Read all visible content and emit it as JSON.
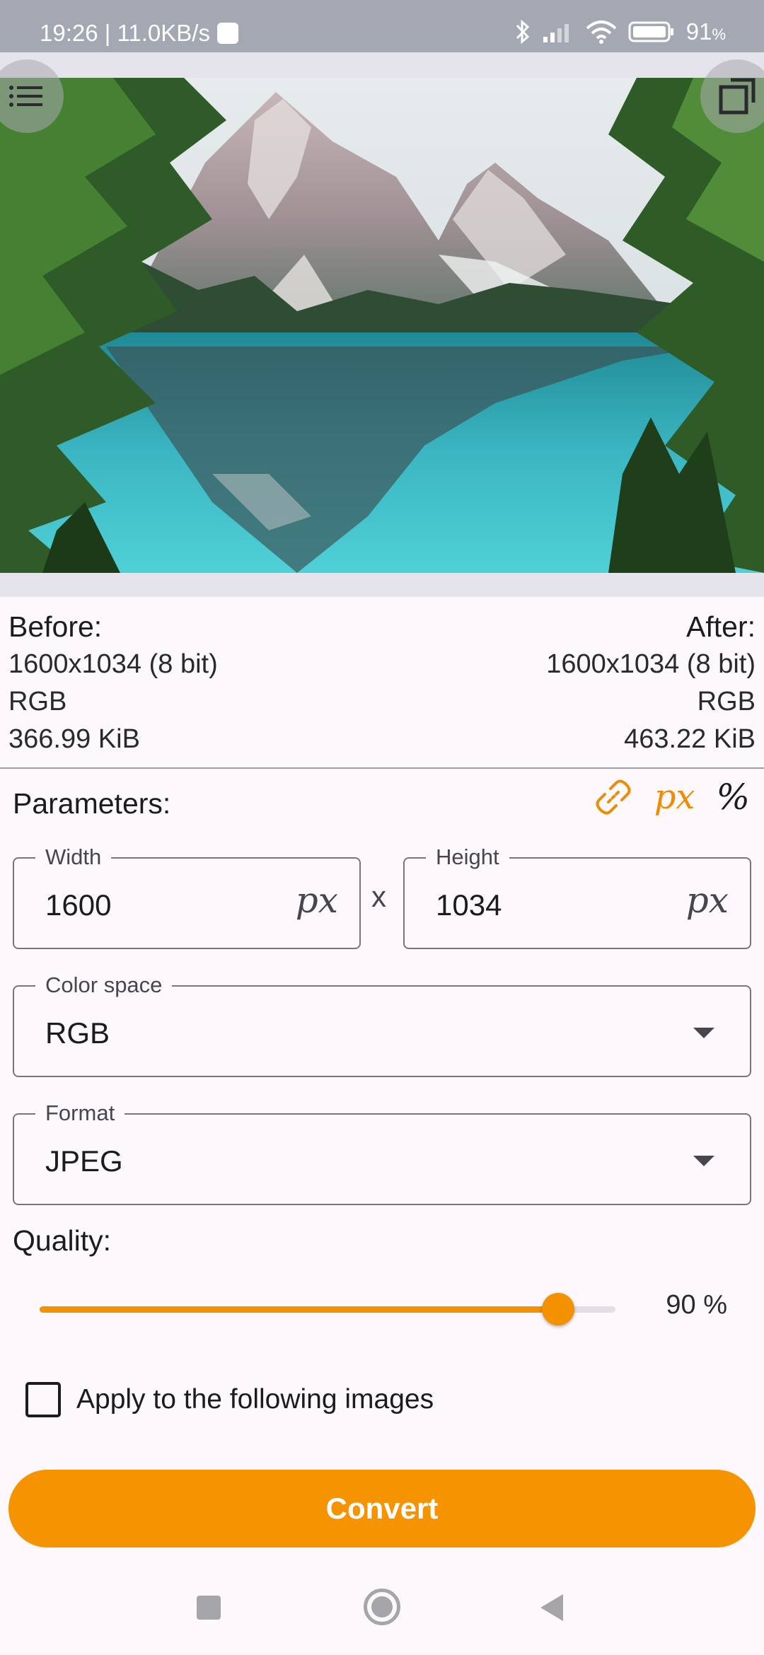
{
  "status_bar": {
    "time_speed": "19:26 | 11.0KB/s",
    "battery_value": "91",
    "battery_unit": "%"
  },
  "image_preview": {
    "menu_icon": "menu-list-icon",
    "expand_icon": "expand-icon"
  },
  "info": {
    "before": {
      "label": "Before:",
      "dimensions": "1600x1034 (8 bit)",
      "color_space": "RGB",
      "size": "366.99 KiB"
    },
    "after": {
      "label": "After:",
      "dimensions": "1600x1034 (8 bit)",
      "color_space": "RGB",
      "size": "463.22 KiB"
    }
  },
  "parameters": {
    "title": "Parameters:",
    "link_icon": "link-icon",
    "unit_px": "px",
    "unit_percent": "%",
    "width": {
      "label": "Width",
      "value": "1600",
      "suffix": "px"
    },
    "separator": "x",
    "height": {
      "label": "Height",
      "value": "1034",
      "suffix": "px"
    },
    "color_space": {
      "label": "Color space",
      "value": "RGB"
    },
    "format": {
      "label": "Format",
      "value": "JPEG"
    }
  },
  "quality": {
    "title": "Quality:",
    "value": 90,
    "value_text": "90 %"
  },
  "apply_checkbox": {
    "label": "Apply to the following images",
    "checked": false
  },
  "convert_button": {
    "label": "Convert"
  },
  "colors": {
    "accent": "#f59300",
    "status_bar": "#a3a8b3",
    "background": "#fdf8fc"
  }
}
